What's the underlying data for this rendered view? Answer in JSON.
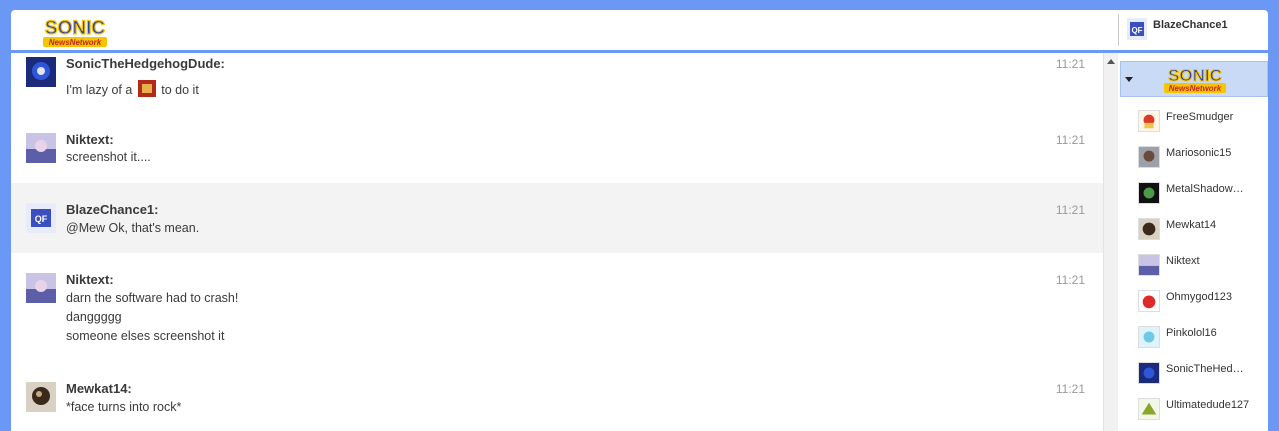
{
  "header": {
    "logo_alt": "Sonic News Network",
    "current_user": "BlazeChance1"
  },
  "messages": [
    {
      "user": "SonicTheHedgehogDude:",
      "time": "11:21",
      "lines": [
        "I'm lazy of a",
        "to do it"
      ]
    },
    {
      "user": "Niktext:",
      "time": "11:21",
      "lines": [
        "screenshot it...."
      ]
    },
    {
      "user": "BlazeChance1:",
      "time": "11:21",
      "lines": [
        "@Mew Ok, that's mean."
      ]
    },
    {
      "user": "Niktext:",
      "time": "11:21",
      "lines": [
        "darn the software had to crash!",
        "danggggg",
        "someone elses screenshot it"
      ]
    },
    {
      "user": "Mewkat14:",
      "time": "11:21",
      "lines": [
        "*face turns into rock*"
      ]
    }
  ],
  "rail": {
    "users": [
      "FreeSmudger",
      "Mariosonic15",
      "MetalShadow…",
      "Mewkat14",
      "Niktext",
      "Ohmygod123",
      "Pinkolol16",
      "SonicTheHed…",
      "Ultimatedude127"
    ]
  },
  "colors": {
    "frame": "#6b97f5",
    "rail_header": "#c8daf5",
    "alt_row": "#f3f3f3"
  }
}
